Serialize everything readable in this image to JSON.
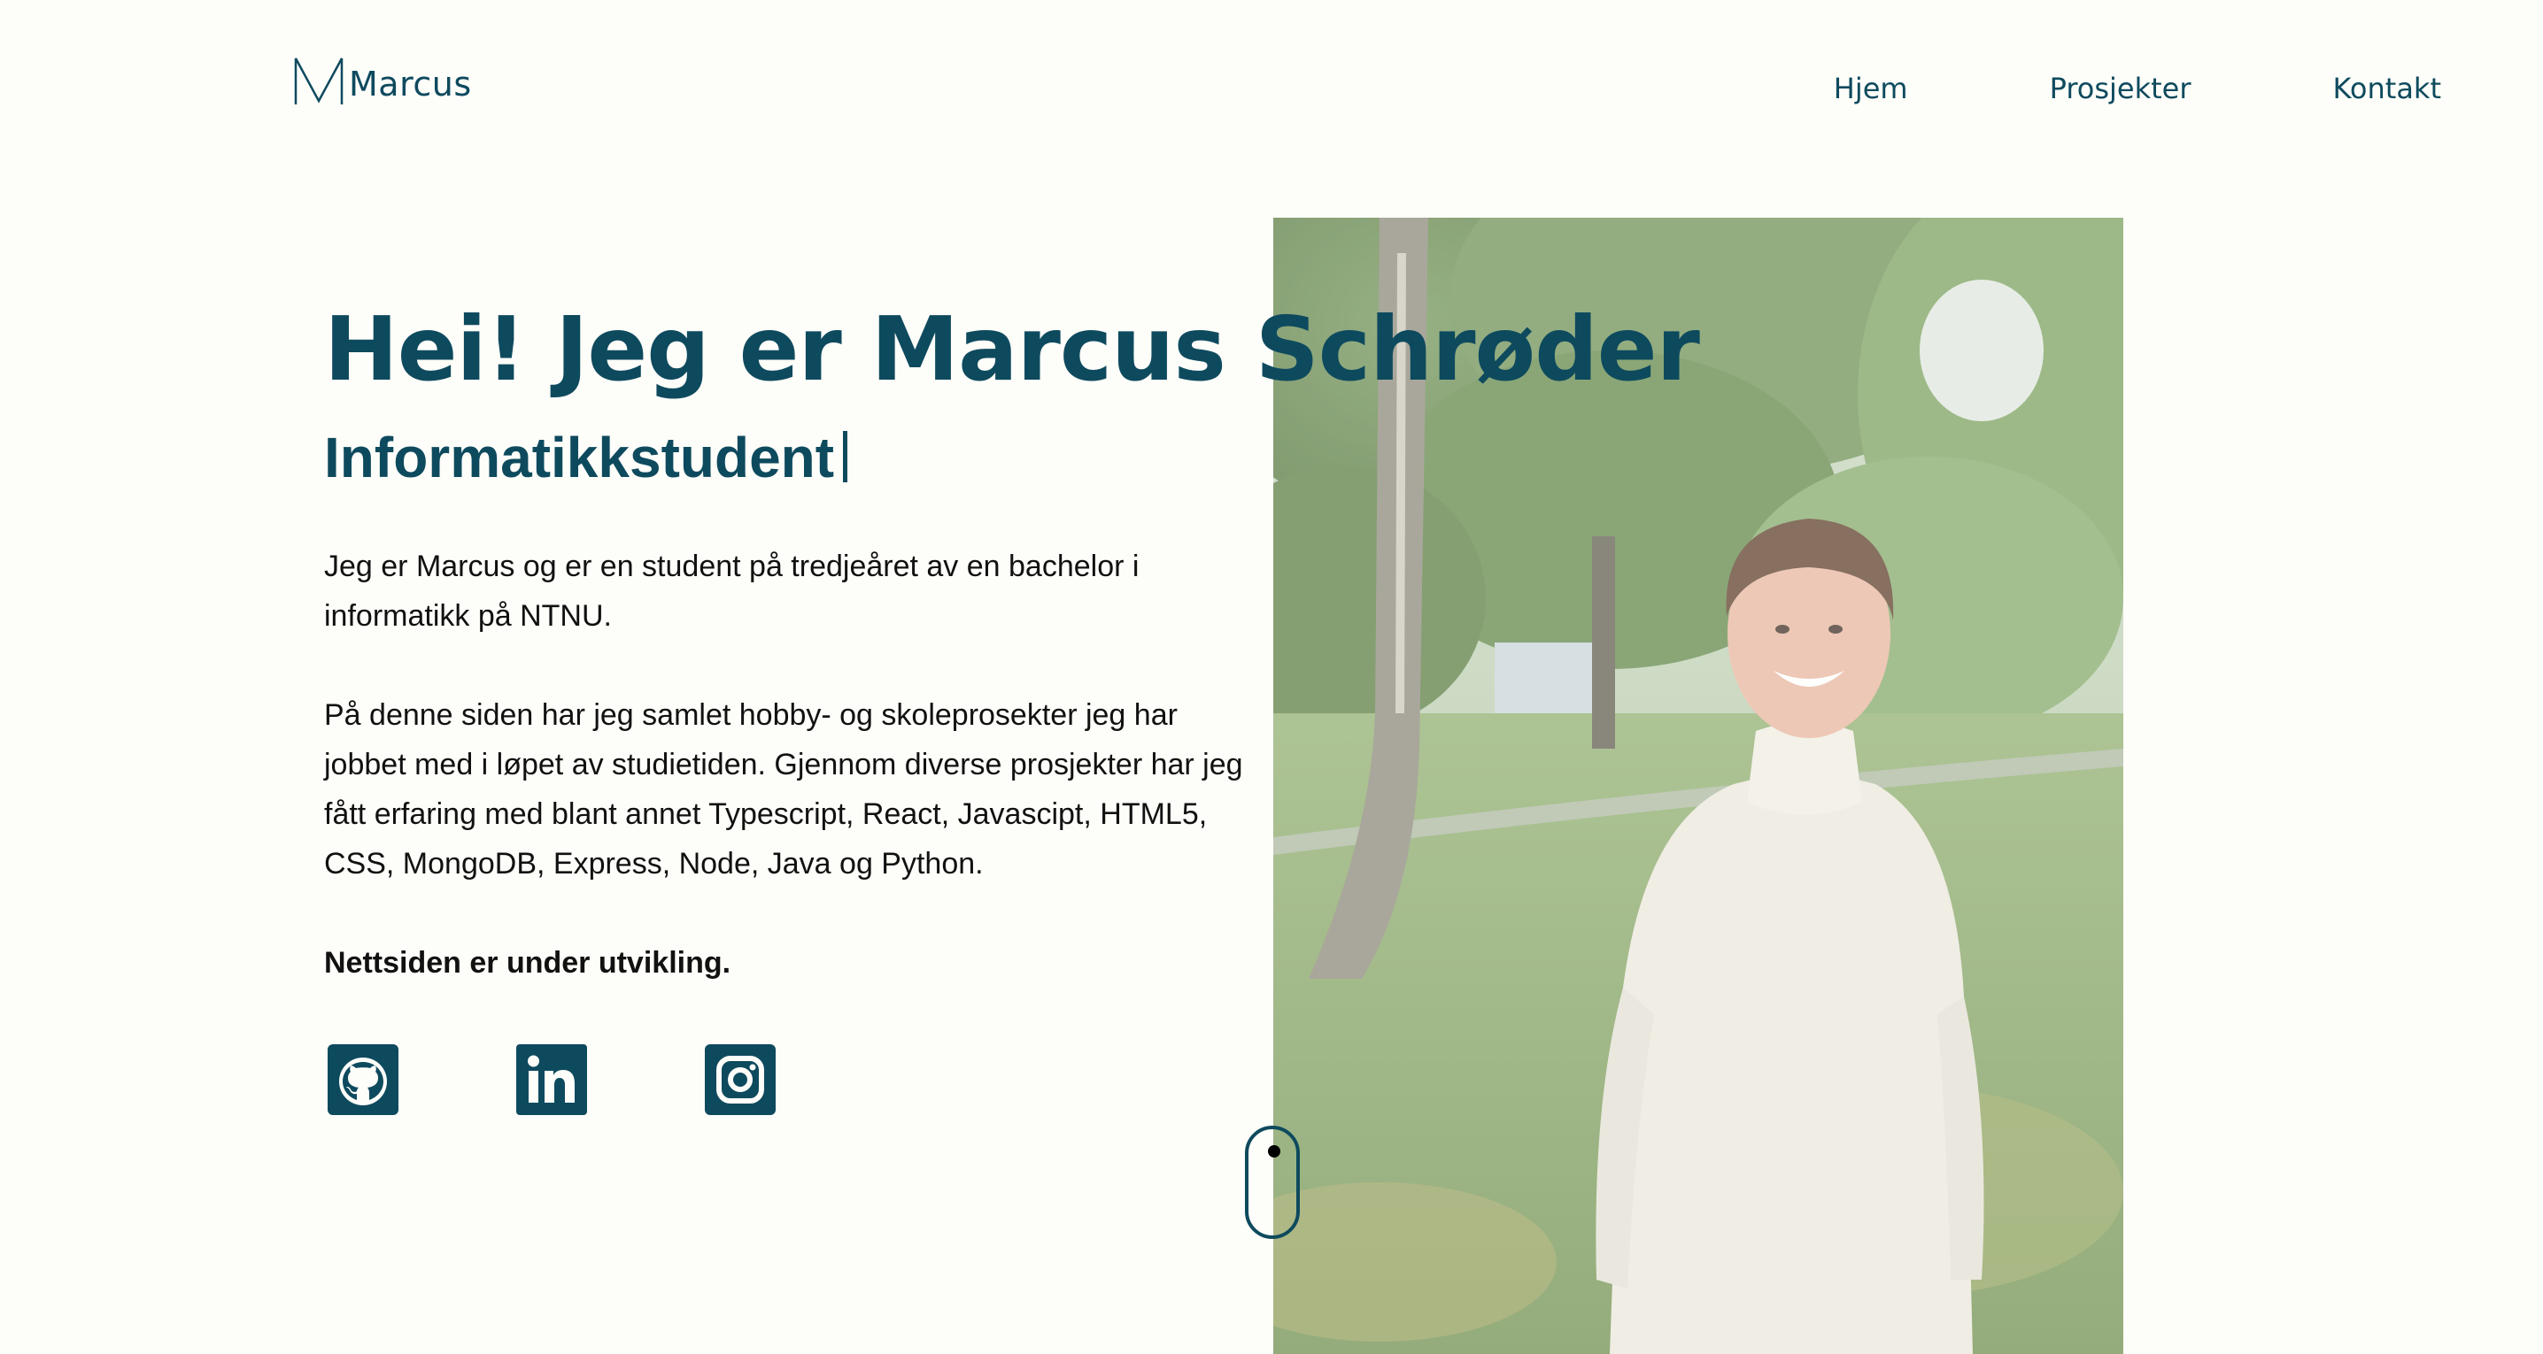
{
  "header": {
    "logo_text": "Marcus",
    "nav": [
      {
        "label": "Hjem"
      },
      {
        "label": "Prosjekter"
      },
      {
        "label": "Kontakt"
      }
    ]
  },
  "hero": {
    "title": "Hei! Jeg er Marcus Schrøder",
    "subtitle": "Informatikkstudent",
    "paragraphs": [
      "Jeg er Marcus og er en student på tredjeåret av en bachelor i informatikk på NTNU.",
      "På denne siden har jeg samlet hobby- og skoleprosekter jeg har jobbet med i løpet av studietiden. Gjennom diverse prosjekter har jeg fått erfaring med blant annet Typescript, React, Javascipt, HTML5, CSS, MongoDB, Express, Node, Java og Python.",
      "Nettsiden er under utvikling."
    ],
    "photo_icon": "portrait-photo"
  },
  "socials": [
    {
      "icon": "github-icon"
    },
    {
      "icon": "linkedin-icon"
    },
    {
      "icon": "instagram-icon"
    }
  ],
  "scroll_indicator": {
    "icon": "mouse-scroll-icon"
  },
  "colors": {
    "accent": "#0e4a5e",
    "background": "#fdfdf9",
    "text": "#111111"
  }
}
